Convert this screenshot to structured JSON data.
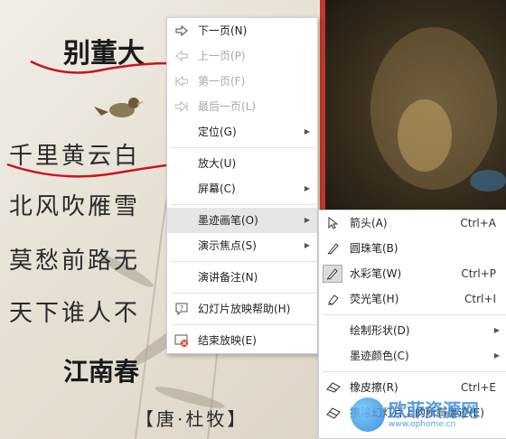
{
  "slide": {
    "title": "别董大",
    "bracket": "【",
    "lines": [
      "千里黄云白",
      "北风吹雁雪",
      "莫愁前路无",
      "天下谁人不"
    ],
    "second_title": "江南春",
    "author": "【唐·杜牧】"
  },
  "context_menu": {
    "items": [
      {
        "label": "下一页(N)",
        "icon": "arrow-right-icon",
        "disabled": false
      },
      {
        "label": "上一页(P)",
        "icon": "arrow-left-icon",
        "disabled": true
      },
      {
        "label": "第一页(F)",
        "icon": "arrow-first-icon",
        "disabled": true
      },
      {
        "label": "最后一页(L)",
        "icon": "arrow-last-icon",
        "disabled": true
      },
      {
        "label": "定位(G)",
        "submenu": true
      },
      {
        "label": "放大(U)"
      },
      {
        "label": "屏幕(C)",
        "submenu": true
      },
      {
        "label": "墨迹画笔(O)",
        "submenu": true,
        "active": true
      },
      {
        "label": "演示焦点(S)",
        "submenu": true
      },
      {
        "label": "演讲备注(N)"
      },
      {
        "label": "幻灯片放映帮助(H)",
        "icon": "help-icon"
      },
      {
        "label": "结束放映(E)",
        "icon": "end-show-icon"
      }
    ]
  },
  "pen_menu": {
    "items": [
      {
        "label": "箭头(A)",
        "shortcut": "Ctrl+A",
        "icon": "cursor-arrow-icon"
      },
      {
        "label": "圆珠笔(B)",
        "icon": "ballpoint-pen-icon"
      },
      {
        "label": "水彩笔(W)",
        "shortcut": "Ctrl+P",
        "icon": "watercolor-pen-icon",
        "selected": true
      },
      {
        "label": "荧光笔(H)",
        "shortcut": "Ctrl+I",
        "icon": "highlighter-icon"
      },
      {
        "label": "绘制形状(D)",
        "submenu": true
      },
      {
        "label": "墨迹颜色(C)",
        "submenu": true
      },
      {
        "label": "橡皮擦(R)",
        "shortcut": "Ctrl+E",
        "icon": "eraser-icon"
      },
      {
        "label": "擦除幻灯片上的所有墨迹(E)",
        "icon": "erase-all-icon"
      }
    ]
  },
  "watermark": {
    "text": "欧菲资源网",
    "url": "www.ophome.cn"
  },
  "colors": {
    "ink_red": "#c8141e",
    "menu_active": "#e6e6e6",
    "disabled_text": "#a8a8a8"
  }
}
